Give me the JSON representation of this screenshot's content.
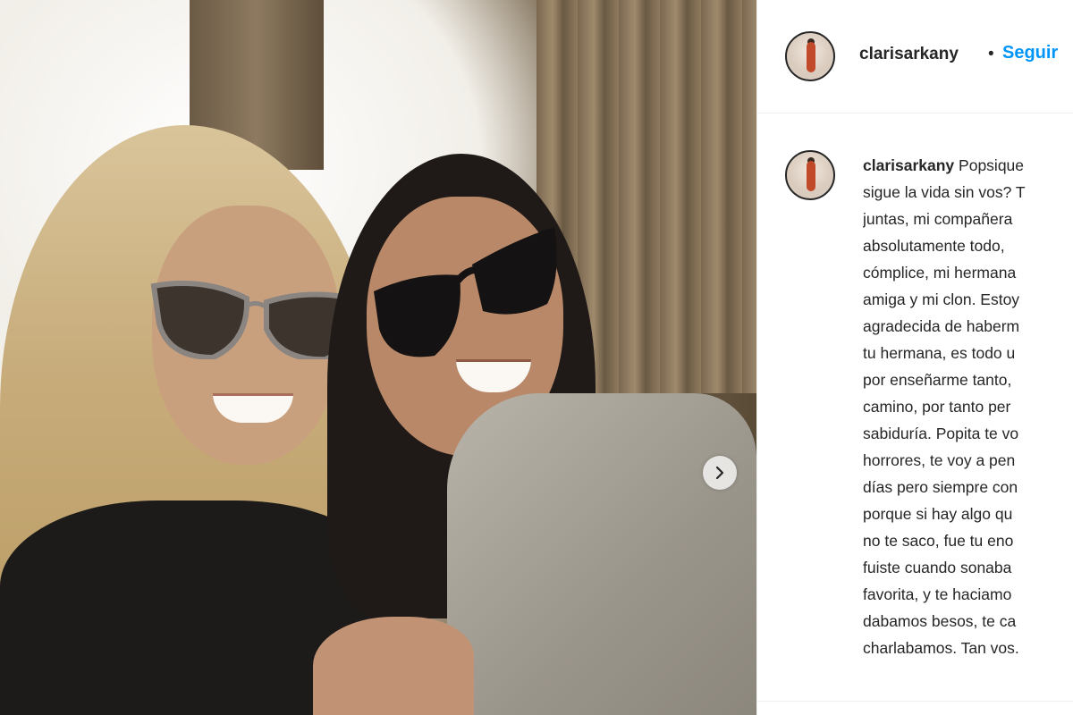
{
  "post": {
    "username": "clarisarkany",
    "dot": "•",
    "follow_label": "Seguir",
    "next_icon": "chevron-right-icon",
    "caption_first": "Popsique",
    "caption_lines": [
      "sigue la vida sin vos? T",
      "juntas, mi compañera",
      "absolutamente todo,",
      "cómplice, mi hermana",
      "amiga y mi clon. Estoy",
      "agradecida de haberm",
      "tu hermana, es todo u",
      "por enseñarme tanto,",
      "camino, por tanto per",
      "sabiduría. Popita te vo",
      "horrores, te voy a pen",
      "días pero siempre con",
      "porque si hay algo qu",
      "no te saco, fue tu eno",
      "fuiste cuando sonaba",
      "favorita, y te haciamo",
      "dabamos besos, te ca",
      "charlabamos. Tan vos."
    ]
  },
  "colors": {
    "follow": "#0095f6",
    "text": "#262626",
    "divider": "#efefef"
  }
}
